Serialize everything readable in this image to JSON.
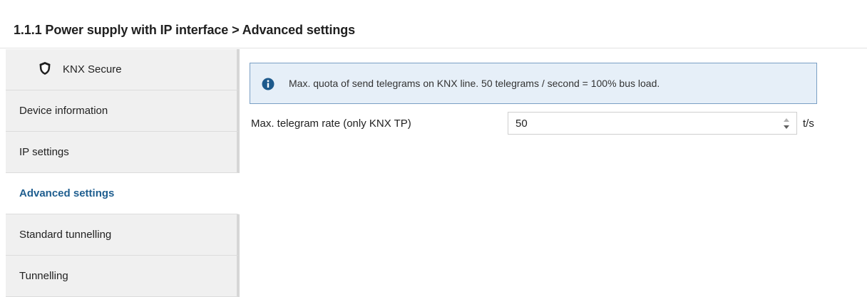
{
  "header": {
    "title": "1.1.1 Power supply with IP interface > Advanced settings"
  },
  "sidebar": {
    "items": [
      {
        "label": "KNX Secure",
        "icon": "shield-icon",
        "active": false
      },
      {
        "label": "Device information",
        "active": false
      },
      {
        "label": "IP settings",
        "active": false
      },
      {
        "label": "Advanced settings",
        "active": true
      },
      {
        "label": "Standard tunnelling",
        "active": false
      },
      {
        "label": "Tunnelling",
        "active": false
      }
    ]
  },
  "info": {
    "icon": "info-icon",
    "text": "Max. quota of send telegrams on KNX line. 50 telegrams / second = 100% bus load."
  },
  "parameter": {
    "label": "Max. telegram rate (only KNX TP)",
    "value": "50",
    "unit": "t/s"
  },
  "colors": {
    "active_text": "#1f5e8f",
    "info_background": "#e6eff8",
    "info_border": "#7a9fc4",
    "info_icon": "#1e5a8c",
    "sidebar_background": "#f0f0f0"
  }
}
